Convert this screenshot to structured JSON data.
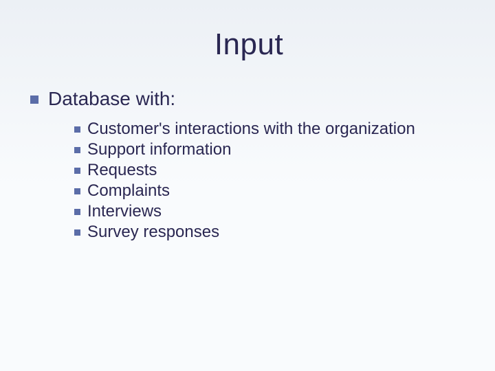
{
  "title": "Input",
  "level1": {
    "text": "Database with:"
  },
  "level2_items": [
    {
      "text": "Customer's interactions with the organization"
    },
    {
      "text": "Support information"
    },
    {
      "text": "Requests"
    },
    {
      "text": "Complaints"
    },
    {
      "text": "Interviews"
    },
    {
      "text": "Survey responses"
    }
  ]
}
